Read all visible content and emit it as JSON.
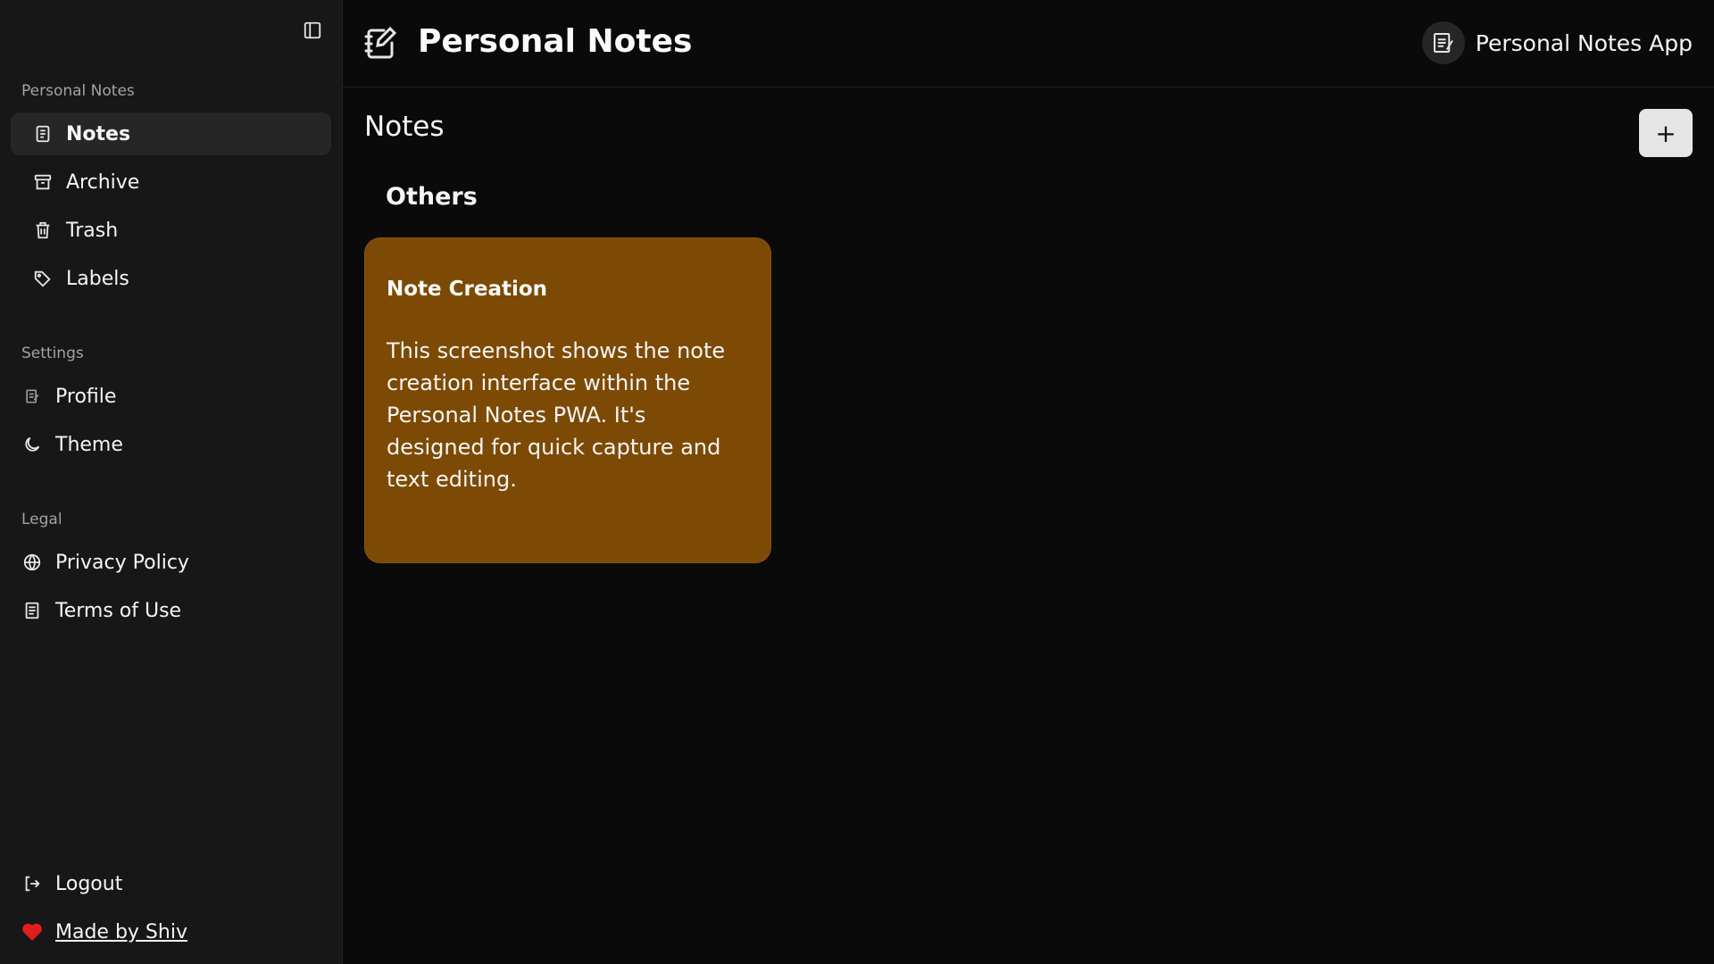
{
  "sidebar": {
    "groups": {
      "personal": "Personal Notes",
      "settings": "Settings",
      "legal": "Legal"
    },
    "items": {
      "notes": "Notes",
      "archive": "Archive",
      "trash": "Trash",
      "labels": "Labels",
      "profile": "Profile",
      "theme": "Theme",
      "privacy": "Privacy Policy",
      "terms": "Terms of Use",
      "logout": "Logout",
      "made_by": "Made by Shiv"
    },
    "active": "notes"
  },
  "header": {
    "title": "Personal Notes",
    "app_name": "Personal Notes App"
  },
  "main": {
    "page_title": "Notes",
    "add_label": "+",
    "section": "Others",
    "notes": [
      {
        "title": "Note Creation",
        "body": "This screenshot shows the note creation interface within the Personal Notes PWA. It's designed for quick capture and text editing.",
        "color": "#7c4a05"
      }
    ]
  },
  "colors": {
    "background": "#0a0a0a",
    "sidebar": "#171717",
    "active_item": "#262626",
    "heart": "#e11d1d"
  },
  "icons": {
    "sidebar_toggle": "panel-left-icon",
    "brand": "edit-note-icon",
    "notes": "notes-icon",
    "archive": "archive-icon",
    "trash": "trash-icon",
    "labels": "tags-icon",
    "profile": "notepad-icon",
    "theme": "moon-icon",
    "privacy": "globe-icon",
    "terms": "document-icon",
    "logout": "logout-icon",
    "made_by": "heart-icon"
  }
}
